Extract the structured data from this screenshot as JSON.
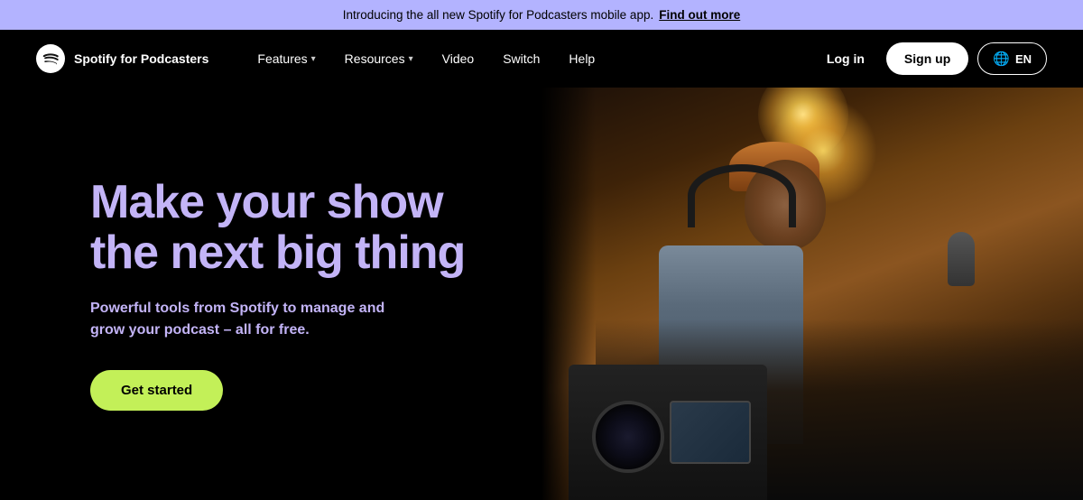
{
  "banner": {
    "text": "Introducing the all new Spotify for Podcasters mobile app.",
    "link_text": "Find out more"
  },
  "nav": {
    "logo_text": "Spotify",
    "logo_subtext": " for Podcasters",
    "links": [
      {
        "label": "Features",
        "has_dropdown": true
      },
      {
        "label": "Resources",
        "has_dropdown": true
      },
      {
        "label": "Video",
        "has_dropdown": false
      },
      {
        "label": "Switch",
        "has_dropdown": false
      },
      {
        "label": "Help",
        "has_dropdown": false
      }
    ],
    "login_label": "Log in",
    "signup_label": "Sign up",
    "lang_label": "EN"
  },
  "hero": {
    "title_line1": "Make your show",
    "title_line2": "the next big thing",
    "subtitle": "Powerful tools from Spotify to manage and grow your podcast – all for free.",
    "cta_label": "Get started"
  }
}
